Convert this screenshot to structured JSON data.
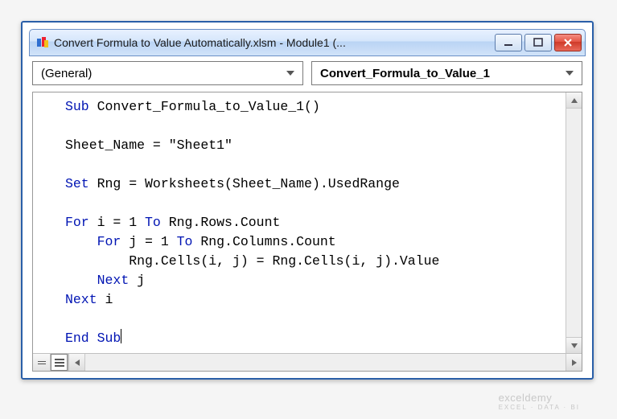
{
  "window": {
    "title": "Convert Formula to Value Automatically.xlsm - Module1 (..."
  },
  "dropdowns": {
    "object": "(General)",
    "procedure": "Convert_Formula_to_Value_1"
  },
  "code": {
    "lines": [
      {
        "tokens": [
          {
            "t": "Sub ",
            "k": true
          },
          {
            "t": "Convert_Formula_to_Value_1()",
            "k": false
          }
        ]
      },
      {
        "tokens": [
          {
            "t": "",
            "k": false
          }
        ]
      },
      {
        "tokens": [
          {
            "t": "Sheet_Name = ",
            "k": false
          },
          {
            "t": "\"Sheet1\"",
            "k": false
          }
        ]
      },
      {
        "tokens": [
          {
            "t": "",
            "k": false
          }
        ]
      },
      {
        "tokens": [
          {
            "t": "Set ",
            "k": true
          },
          {
            "t": "Rng = Worksheets(Sheet_Name).UsedRange",
            "k": false
          }
        ]
      },
      {
        "tokens": [
          {
            "t": "",
            "k": false
          }
        ]
      },
      {
        "tokens": [
          {
            "t": "For ",
            "k": true
          },
          {
            "t": "i = 1 ",
            "k": false
          },
          {
            "t": "To ",
            "k": true
          },
          {
            "t": "Rng.Rows.Count",
            "k": false
          }
        ]
      },
      {
        "tokens": [
          {
            "t": "    ",
            "k": false
          },
          {
            "t": "For ",
            "k": true
          },
          {
            "t": "j = 1 ",
            "k": false
          },
          {
            "t": "To ",
            "k": true
          },
          {
            "t": "Rng.Columns.Count",
            "k": false
          }
        ]
      },
      {
        "tokens": [
          {
            "t": "        Rng.Cells(i, j) = Rng.Cells(i, j).Value",
            "k": false
          }
        ]
      },
      {
        "tokens": [
          {
            "t": "    ",
            "k": false
          },
          {
            "t": "Next ",
            "k": true
          },
          {
            "t": "j",
            "k": false
          }
        ]
      },
      {
        "tokens": [
          {
            "t": "Next ",
            "k": true
          },
          {
            "t": "i",
            "k": false
          }
        ]
      },
      {
        "tokens": [
          {
            "t": "",
            "k": false
          }
        ]
      },
      {
        "tokens": [
          {
            "t": "End Sub",
            "k": true
          }
        ],
        "caret": true
      }
    ]
  },
  "watermark": {
    "main": "exceldemy",
    "sub": "EXCEL · DATA · BI"
  }
}
